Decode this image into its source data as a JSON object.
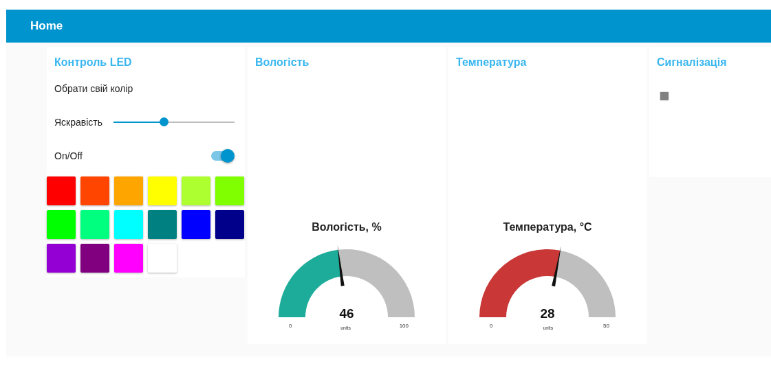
{
  "header": {
    "title": "Home"
  },
  "led_card": {
    "title": "Контроль LED",
    "picker_label": "Обрати свій колір",
    "brightness": {
      "label": "Яскравість",
      "level": 0.41
    },
    "power": {
      "label": "On/Off",
      "on": true
    },
    "swatches": [
      {
        "color": "#ff0000"
      },
      {
        "color": "#ff4500"
      },
      {
        "color": "#ffa500"
      },
      {
        "color": "#ffff00"
      },
      {
        "color": "#adff2f"
      },
      {
        "color": "#7fff00"
      },
      {
        "color": "#00ff00"
      },
      {
        "color": "#00ff7f"
      },
      {
        "color": "#00ffff"
      },
      {
        "color": "#008080"
      },
      {
        "color": "#0000ff"
      },
      {
        "color": "#00008b"
      },
      {
        "color": "#9400d3"
      },
      {
        "color": "#800080"
      },
      {
        "color": "#ff00ff"
      },
      {
        "color": "#ffffff"
      }
    ]
  },
  "gauges": [
    {
      "card_title": "Вологість",
      "title": "Вологість, %",
      "value": "46",
      "units": "units",
      "min": "0",
      "max": "100",
      "level": 0.46,
      "color": "#1dac99"
    },
    {
      "card_title": "Температура",
      "title": "Температура, °C",
      "value": "28",
      "units": "units",
      "min": "0",
      "max": "50",
      "level": 0.56,
      "color": "#c93737"
    }
  ],
  "alarm_card": {
    "title": "Сигналізація",
    "indicator": {
      "color": "#808080"
    }
  }
}
